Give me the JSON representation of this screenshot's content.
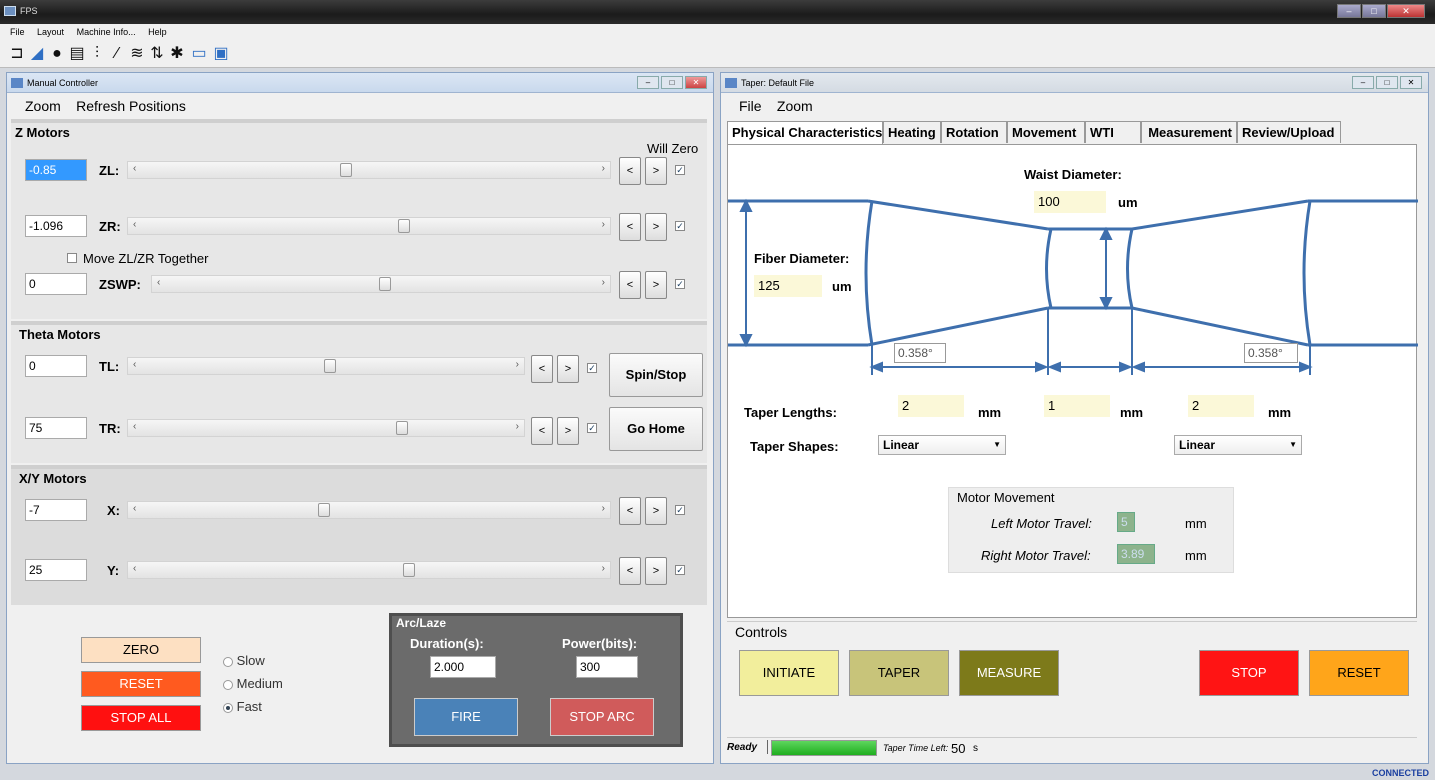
{
  "app": {
    "title": "FPS",
    "status": "CONNECTED"
  },
  "menu": {
    "file": "File",
    "layout": "Layout",
    "machine_info": "Machine Info...",
    "help": "Help"
  },
  "toolbar_icons": [
    "laser-icon",
    "fiber-icon",
    "record-icon",
    "film-icon",
    "sliders-icon",
    "probe-icon",
    "database-icon",
    "upload-icon",
    "bug-icon",
    "window-icon",
    "windows-icon"
  ],
  "manual": {
    "title": "Manual Controller",
    "menu": {
      "zoom": "Zoom",
      "refresh": "Refresh Positions"
    },
    "z_motors": {
      "header": "Z Motors",
      "will_zero": "Will Zero",
      "zl": {
        "label": "ZL:",
        "value": "-0.85",
        "position": 0.44
      },
      "zr": {
        "label": "ZR:",
        "value": "-1.096",
        "position": 0.57
      },
      "together": "Move ZL/ZR Together",
      "zswp": {
        "label": "ZSWP:",
        "value": "0",
        "position": 0.5
      }
    },
    "theta_motors": {
      "header": "Theta Motors",
      "tl": {
        "label": "TL:",
        "value": "0",
        "position": 0.5
      },
      "tr": {
        "label": "TR:",
        "value": "75",
        "position": 0.7
      },
      "spin_stop": "Spin/Stop",
      "go_home": "Go Home"
    },
    "xy_motors": {
      "header": "X/Y Motors",
      "x": {
        "label": "X:",
        "value": "-7",
        "position": 0.39
      },
      "y": {
        "label": "Y:",
        "value": "25",
        "position": 0.58
      }
    },
    "buttons": {
      "zero": "ZERO",
      "reset": "RESET",
      "stop_all": "STOP ALL"
    },
    "speed": {
      "slow": "Slow",
      "medium": "Medium",
      "fast": "Fast",
      "selected": "Fast"
    },
    "arc": {
      "header": "Arc/Laze",
      "duration_label": "Duration(s):",
      "duration": "2.000",
      "power_label": "Power(bits):",
      "power": "300",
      "fire": "FIRE",
      "stop_arc": "STOP ARC"
    }
  },
  "taper": {
    "title": "Taper: Default File",
    "menu": {
      "file": "File",
      "zoom": "Zoom"
    },
    "tabs": [
      "Physical Characteristics",
      "Heating",
      "Rotation",
      "Movement",
      "WTI",
      "Measurement",
      "Review/Upload"
    ],
    "active_tab": "Physical Characteristics",
    "waist_label": "Waist Diameter:",
    "waist_value": "100",
    "waist_unit": "um",
    "fiber_label": "Fiber Diameter:",
    "fiber_value": "125",
    "fiber_unit": "um",
    "angle_left": "0.358°",
    "angle_right": "0.358°",
    "lengths_label": "Taper Lengths:",
    "lengths": [
      "2",
      "1",
      "2"
    ],
    "length_unit": "mm",
    "shapes_label": "Taper Shapes:",
    "shape_left": "Linear",
    "shape_right": "Linear",
    "motor_header": "Motor Movement",
    "left_travel_label": "Left Motor Travel:",
    "left_travel": "5",
    "right_travel_label": "Right Motor Travel:",
    "right_travel": "3.89",
    "travel_unit": "mm",
    "controls_header": "Controls",
    "buttons": {
      "initiate": "INITIATE",
      "taper": "TAPER",
      "measure": "MEASURE",
      "stop": "STOP",
      "reset": "RESET"
    },
    "status": {
      "ready": "Ready",
      "progress": 1.0,
      "time_left_label": "Taper Time Left:",
      "time_left": "50",
      "time_unit": "s"
    }
  },
  "colors": {
    "zero": "#fde0c2",
    "reset": "#ff5a1f",
    "stop_all": "#ff1010",
    "fire": "#4a82b8",
    "stop_arc": "#d05b5b",
    "initiate": "#f2ee9c",
    "taper": "#c8c47a",
    "measure": "#7d7a1a",
    "stop": "#ff1414",
    "reset_taper": "#ffa51a",
    "fiber": "#3e6fad"
  }
}
